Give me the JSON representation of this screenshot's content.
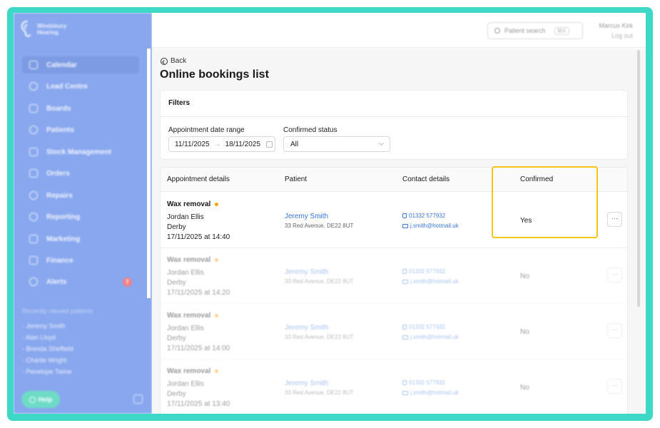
{
  "brand": {
    "name": "Windsbury Hearing"
  },
  "sidebar": {
    "items": [
      {
        "label": "Calendar",
        "icon": "calendar-icon"
      },
      {
        "label": "Lead Centre",
        "icon": "headset-icon"
      },
      {
        "label": "Boards",
        "icon": "board-icon"
      },
      {
        "label": "Patients",
        "icon": "patients-icon"
      },
      {
        "label": "Stock Management",
        "icon": "box-icon"
      },
      {
        "label": "Orders",
        "icon": "orders-icon"
      },
      {
        "label": "Repairs",
        "icon": "wrench-icon"
      },
      {
        "label": "Reporting",
        "icon": "pie-icon"
      },
      {
        "label": "Marketing",
        "icon": "mail-icon"
      },
      {
        "label": "Finance",
        "icon": "card-icon"
      },
      {
        "label": "Alerts",
        "icon": "bell-icon",
        "badge": "7"
      }
    ],
    "recent_title": "Recently viewed patients",
    "recent": [
      "- Jeremy Smith",
      "- Alan Lloyd",
      "- Brenda Sheffield",
      "- Charlie Wright",
      "- Penelope Twine"
    ],
    "help_label": "Help"
  },
  "topbar": {
    "search_placeholder": "Patient search",
    "search_shortcut": "⌘K",
    "user_name": "Marcus Kirk",
    "logout_label": "Log out"
  },
  "page": {
    "back_label": "Back",
    "title": "Online bookings list"
  },
  "filters": {
    "title": "Filters",
    "date_label": "Appointment date range",
    "date_from": "11/11/2025",
    "date_arrow": "→",
    "date_to": "18/11/2025",
    "status_label": "Confirmed status",
    "status_value": "All"
  },
  "table": {
    "headers": [
      "Appointment details",
      "Patient",
      "Contact details",
      "Confirmed"
    ],
    "more_label": "···",
    "rows": [
      {
        "type": "Wax removal",
        "practitioner": "Jordan Ellis",
        "location": "Derby",
        "datetime": "17/11/2025 at 14:40",
        "patient": "Jeremy Smith",
        "address": "33 Red Avenue, DE22 8UT",
        "phone": "01332 577932",
        "email": "j.smith@hotmail.uk",
        "confirmed": "Yes"
      },
      {
        "type": "Wax removal",
        "practitioner": "Jordan Ellis",
        "location": "Derby",
        "datetime": "17/11/2025 at 14:20",
        "patient": "Jeremy Smith",
        "address": "33 Red Avenue, DE22 8UT",
        "phone": "01332 577932",
        "email": "j.smith@hotmail.uk",
        "confirmed": "No"
      },
      {
        "type": "Wax removal",
        "practitioner": "Jordan Ellis",
        "location": "Derby",
        "datetime": "17/11/2025 at 14:00",
        "patient": "Jeremy Smith",
        "address": "33 Red Avenue, DE22 8UT",
        "phone": "01332 577932",
        "email": "j.smith@hotmail.uk",
        "confirmed": "No"
      },
      {
        "type": "Wax removal",
        "practitioner": "Jordan Ellis",
        "location": "Derby",
        "datetime": "17/11/2025 at 13:40",
        "patient": "Jeremy Smith",
        "address": "33 Red Avenue, DE22 8UT",
        "phone": "01332 577932",
        "email": "j.smith@hotmail.uk",
        "confirmed": "No"
      }
    ]
  },
  "colors": {
    "frame": "#3ed9c6",
    "sidebar": "#88a7ee",
    "link": "#3b78d8",
    "status_dot": "#f2a700",
    "highlight": "#f5c518"
  }
}
